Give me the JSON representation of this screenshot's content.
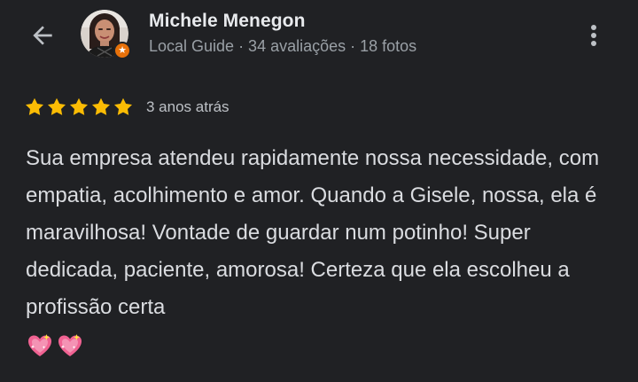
{
  "header": {
    "back_icon": "arrow-back-icon",
    "more_icon": "more-vert-icon"
  },
  "reviewer": {
    "name": "Michele Menegon",
    "meta": "Local Guide · 34 avaliações · 18 fotos",
    "badge_icon": "local-guide-star-icon"
  },
  "review": {
    "rating": 5,
    "rating_max": 5,
    "star_color": "#fbbc04",
    "time_ago": "3 anos atrás",
    "text": "Sua empresa atendeu rapidamente nossa necessidade, com empatia, acolhimento e amor. Quando a Gisele, nossa, ela é maravilhosa! Vontade de guardar num potinho! Super dedicada, paciente, amorosa! Certeza que ela escolheu a profissão certa",
    "emojis": [
      "sparkling-heart-icon",
      "sparkling-heart-icon"
    ]
  },
  "colors": {
    "background": "#202124",
    "badge": "#e8710a"
  }
}
